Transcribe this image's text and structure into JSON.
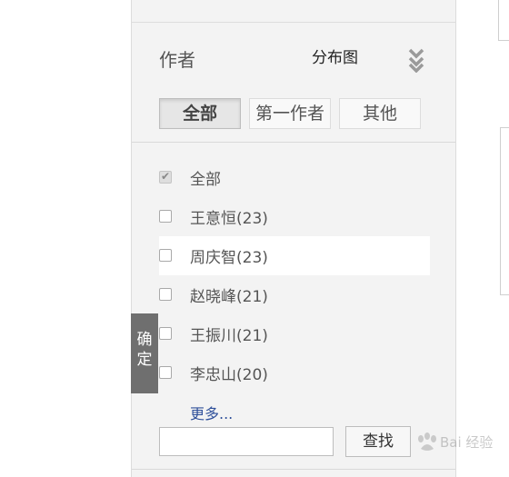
{
  "panel": {
    "title": "作者",
    "distribution_link": "分布图"
  },
  "tabs": [
    {
      "label": "全部",
      "active": true
    },
    {
      "label": "第一作者",
      "active": false
    },
    {
      "label": "其他",
      "active": false
    }
  ],
  "author_list": [
    {
      "label": "全部",
      "checked": true
    },
    {
      "label": "王意恒(23)",
      "checked": false
    },
    {
      "label": "周庆智(23)",
      "checked": false
    },
    {
      "label": "赵晓峰(21)",
      "checked": false
    },
    {
      "label": "王振川(21)",
      "checked": false
    },
    {
      "label": "李忠山(20)",
      "checked": false
    }
  ],
  "more_link": "更多...",
  "search": {
    "value": "",
    "button_label": "查找"
  },
  "confirm_tab_label": "确定",
  "watermark": {
    "text": "Bai 经验"
  },
  "colors": {
    "panel_bg": "#f3f3f3",
    "link_blue": "#2e4f9a",
    "confirm_tab_bg": "#707070"
  }
}
